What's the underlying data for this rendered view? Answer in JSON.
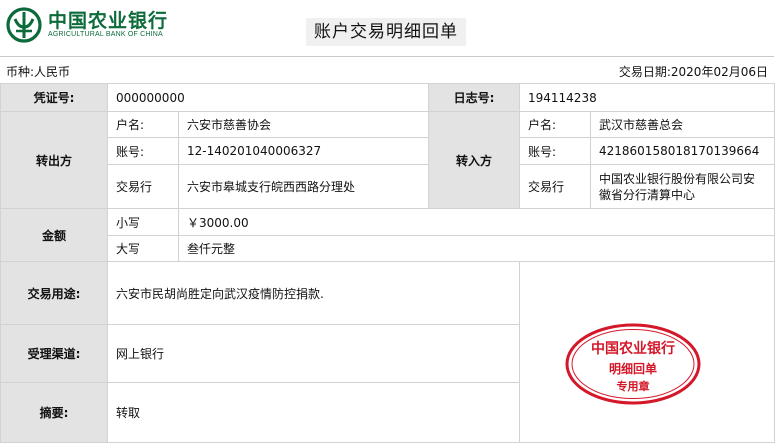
{
  "header": {
    "bank_name_cn": "中国农业银行",
    "bank_name_en": "AGRICULTURAL BANK OF CHINA",
    "document_title": "账户交易明细回单",
    "logo_icon": "abc-bank-logo-icon",
    "brand_color": "#0b6b3a"
  },
  "meta": {
    "currency_label": "币种:",
    "currency": "人民币",
    "date_label": "交易日期:",
    "date": "2020年02月06日"
  },
  "voucher": {
    "label": "凭证号:",
    "value": "000000000"
  },
  "log": {
    "label": "日志号:",
    "value": "194114238"
  },
  "payer": {
    "label": "转出方",
    "name_label": "户名:",
    "name": "六安市慈善协会",
    "account_label": "账号:",
    "account": "12-140201040006327",
    "bank_label": "交易行",
    "bank": "六安市皋城支行皖西西路分理处"
  },
  "payee": {
    "label": "转入方",
    "name_label": "户名:",
    "name": "武汉市慈善总会",
    "account_label": "账号:",
    "account": "421860158018170139664",
    "bank_label": "交易行",
    "bank": "中国农业银行股份有限公司安徽省分行清算中心"
  },
  "amount": {
    "label": "金额",
    "small_label": "小写",
    "small_value": "￥3000.00",
    "big_label": "大写",
    "big_value": "叁仟元整"
  },
  "purpose": {
    "label": "交易用途:",
    "value": "六安市民胡尚胜定向武汉疫情防控捐款."
  },
  "channel": {
    "label": "受理渠道:",
    "value": "网上银行"
  },
  "summary": {
    "label": "摘要:",
    "value": "转取"
  },
  "seal": {
    "line1": "中国农业银行",
    "line2": "明细回单",
    "line3": "专用章",
    "color": "#d4182a"
  }
}
